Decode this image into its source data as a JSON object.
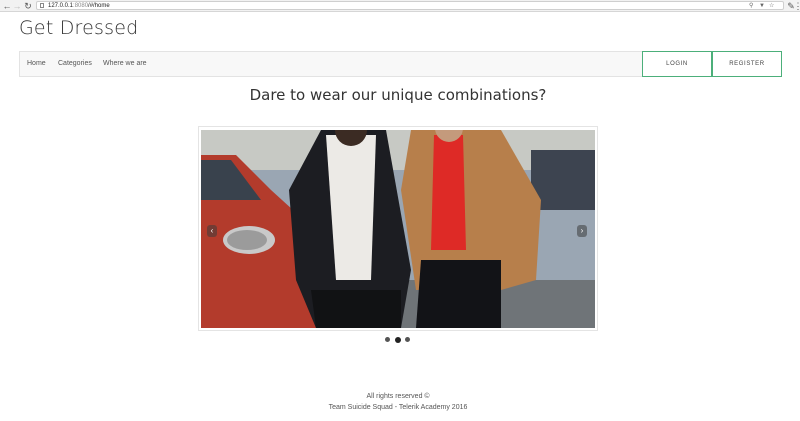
{
  "browser": {
    "url_host": "127.0.0.1",
    "url_port": ":8080",
    "url_path": "/#/home"
  },
  "site": {
    "brand": "Get Dressed",
    "nav": [
      "Home",
      "Categories",
      "Where we are"
    ],
    "login_label": "LOGIN",
    "register_label": "REGISTER",
    "accent_color": "#4caf7a"
  },
  "hero": {
    "tagline": "Dare to wear our unique combinations?",
    "carousel": {
      "slide_count": 3,
      "active_index": 1
    }
  },
  "footer": {
    "line1": "All rights reserved ©",
    "line2": "Team Suicide Squad - Telerik Academy 2016"
  }
}
